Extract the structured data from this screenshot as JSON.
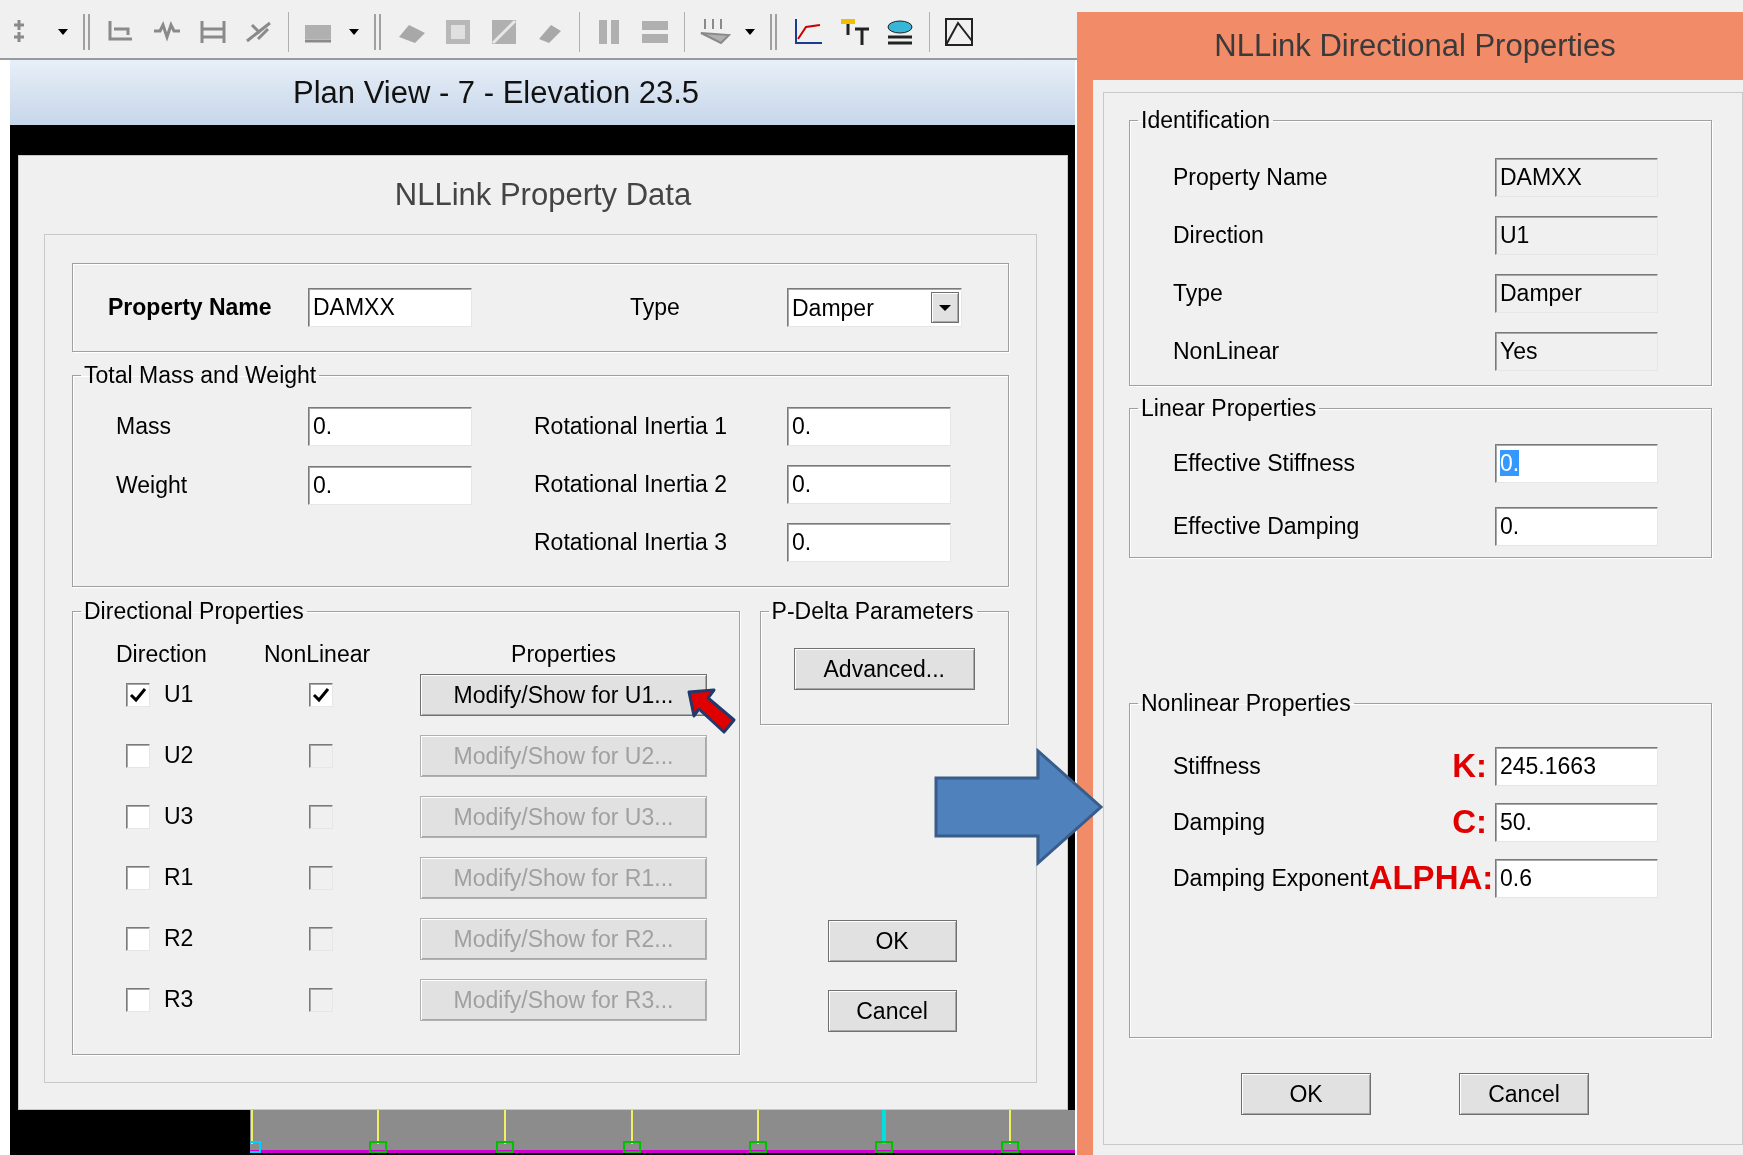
{
  "plan_view": {
    "title": "Plan View - 7 - Elevation 23.5"
  },
  "property_dialog": {
    "title": "NLLink Property Data",
    "property_name": {
      "label": "Property Name",
      "value": "DAMXX"
    },
    "type": {
      "label": "Type",
      "value": "Damper"
    },
    "mass_group": {
      "title": "Total Mass and Weight",
      "left_fields": [
        {
          "label": "Mass",
          "value": "0."
        },
        {
          "label": "Weight",
          "value": "0."
        }
      ],
      "right_fields": [
        {
          "label": "Rotational Inertia 1",
          "value": "0."
        },
        {
          "label": "Rotational Inertia 2",
          "value": "0."
        },
        {
          "label": "Rotational Inertia 3",
          "value": "0."
        }
      ]
    },
    "directional_group": {
      "title": "Directional Properties",
      "columns": [
        "Direction",
        "NonLinear",
        "Properties"
      ],
      "rows": [
        {
          "direction": "U1",
          "checked": true,
          "nonlinear": true,
          "button": "Modify/Show for U1...",
          "disabled": false
        },
        {
          "direction": "U2",
          "checked": false,
          "nonlinear": false,
          "button": "Modify/Show for U2...",
          "disabled": true
        },
        {
          "direction": "U3",
          "checked": false,
          "nonlinear": false,
          "button": "Modify/Show for U3...",
          "disabled": true
        },
        {
          "direction": "R1",
          "checked": false,
          "nonlinear": false,
          "button": "Modify/Show for R1...",
          "disabled": true
        },
        {
          "direction": "R2",
          "checked": false,
          "nonlinear": false,
          "button": "Modify/Show for R2...",
          "disabled": true
        },
        {
          "direction": "R3",
          "checked": false,
          "nonlinear": false,
          "button": "Modify/Show for R3...",
          "disabled": true
        }
      ]
    },
    "pdelta_group": {
      "title": "P-Delta Parameters",
      "button": "Advanced..."
    },
    "buttons": [
      "OK",
      "Cancel"
    ]
  },
  "directional_dialog": {
    "title": "NLLink Directional Properties",
    "identification": {
      "title": "Identification",
      "fields": [
        {
          "label": "Property Name",
          "value": "DAMXX",
          "readonly": true
        },
        {
          "label": "Direction",
          "value": "U1",
          "readonly": true
        },
        {
          "label": "Type",
          "value": "Damper",
          "readonly": true
        },
        {
          "label": "NonLinear",
          "value": "Yes",
          "readonly": true
        }
      ]
    },
    "linear": {
      "title": "Linear Properties",
      "fields": [
        {
          "label": "Effective Stiffness",
          "value": "0.",
          "selected": true
        },
        {
          "label": "Effective Damping",
          "value": "0.",
          "selected": false
        }
      ]
    },
    "nonlinear": {
      "title": "Nonlinear Properties",
      "fields": [
        {
          "label": "Stiffness",
          "value": "245.1663",
          "annotation": "K:"
        },
        {
          "label": "Damping",
          "value": "50.",
          "annotation": "C:"
        },
        {
          "label": "Damping Exponent",
          "value": "0.6",
          "annotation": "ALPHA:"
        }
      ]
    },
    "buttons": [
      "OK",
      "Cancel"
    ]
  }
}
